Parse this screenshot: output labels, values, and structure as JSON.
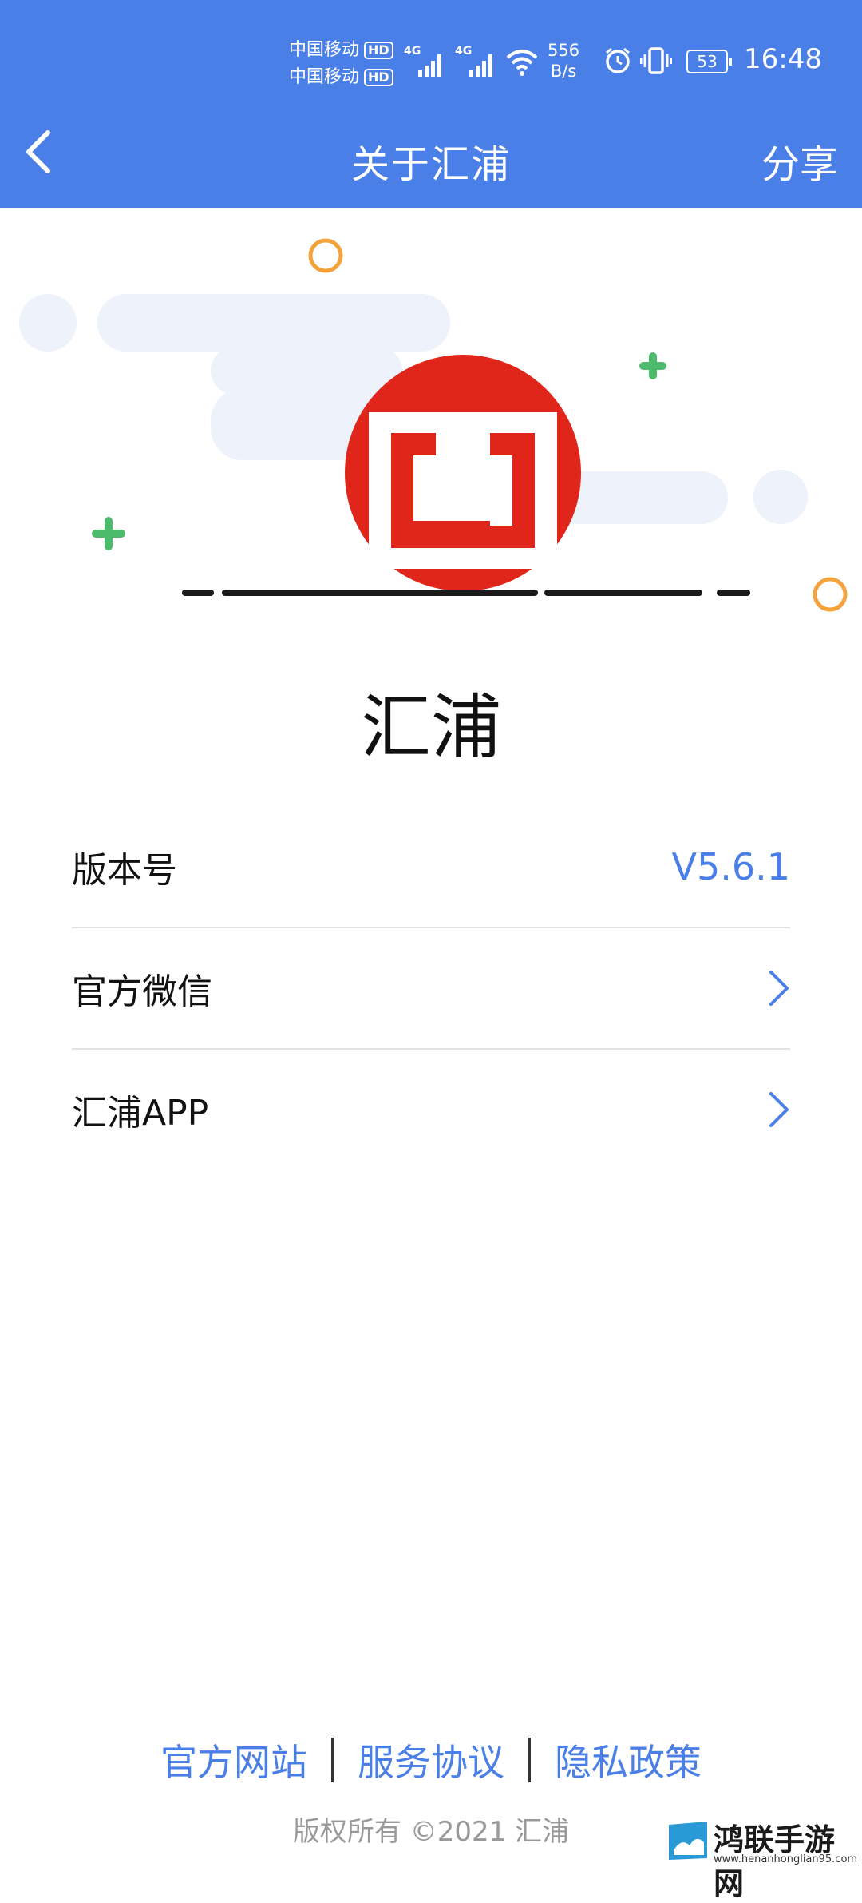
{
  "status_bar": {
    "carrier1": "中国移动",
    "carrier2": "中国移动",
    "hd": "HD",
    "network1": "4G",
    "network2": "4G",
    "speed_value": "556",
    "speed_unit": "B/s",
    "battery": "53",
    "time": "16:48"
  },
  "header": {
    "title": "关于汇浦",
    "share_label": "分享"
  },
  "app_name": "汇浦",
  "list": {
    "version_label": "版本号",
    "version_value": "V5.6.1",
    "wechat_label": "官方微信",
    "app_label": "汇浦APP"
  },
  "footer": {
    "website": "官方网站",
    "service": "服务协议",
    "privacy": "隐私政策",
    "copyright": "版权所有 ©2021 汇浦"
  },
  "watermark": {
    "name": "鸿联手游网",
    "url": "www.henanhonglian95.com"
  },
  "colors": {
    "primary": "#4a7fe8",
    "logo_red": "#e0261b",
    "accent_green": "#4cbb6c",
    "accent_orange": "#f4a23c"
  }
}
